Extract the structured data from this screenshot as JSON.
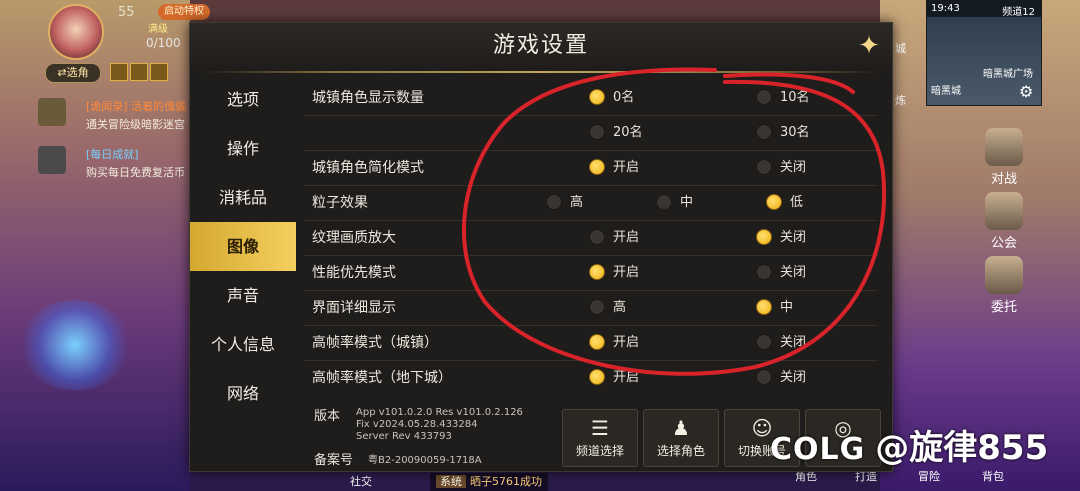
{
  "hud": {
    "level": "55",
    "full_badge": "满级",
    "boost_label": "启动特权",
    "hp_text": "0/100",
    "switch_label": "⇄选角",
    "quests": [
      {
        "title": "[诡闻录] 活着的傀儡",
        "desc": "通关冒险级暗影迷宫",
        "title_color": "#ff8a3a"
      },
      {
        "title": "[每日成就]",
        "desc": "购买每日免费复活币",
        "title_color": "#7ad0ff"
      }
    ]
  },
  "minimap": {
    "time": "19:43",
    "channel": "频道12",
    "map_name": "暗黑城",
    "area_label": "暗黑城广场"
  },
  "right_buttons": [
    {
      "label": "对战"
    },
    {
      "label": "公会"
    },
    {
      "label": "委托"
    }
  ],
  "side_labels": {
    "city": "城",
    "train": "炼"
  },
  "bottom": {
    "social": "社交",
    "chat_tag": "系统",
    "chat_text": "晒子5761成功",
    "bottom_right": [
      "角色",
      "打造",
      "冒险",
      "背包"
    ]
  },
  "watermark": {
    "logo": "COLG",
    "text": "@旋律855"
  },
  "panel": {
    "title": "游戏设置",
    "close_icon": "close-star-icon",
    "tabs": [
      {
        "label": "选项",
        "active": false
      },
      {
        "label": "操作",
        "active": false
      },
      {
        "label": "消耗品",
        "active": false
      },
      {
        "label": "图像",
        "active": true
      },
      {
        "label": "声音",
        "active": false
      },
      {
        "label": "个人信息",
        "active": false
      },
      {
        "label": "网络",
        "active": false
      }
    ],
    "settings": [
      {
        "label": "城镇角色显示数量",
        "options": [
          {
            "label": "0名",
            "selected": true
          },
          {
            "label": "10名",
            "selected": false
          }
        ]
      },
      {
        "label": "",
        "options": [
          {
            "label": "20名",
            "selected": false
          },
          {
            "label": "30名",
            "selected": false
          }
        ]
      },
      {
        "label": "城镇角色简化模式",
        "options": [
          {
            "label": "开启",
            "selected": true
          },
          {
            "label": "关闭",
            "selected": false
          }
        ]
      },
      {
        "label": "粒子效果",
        "options": [
          {
            "label": "高",
            "selected": false
          },
          {
            "label": "中",
            "selected": false
          },
          {
            "label": "低",
            "selected": true
          }
        ]
      },
      {
        "label": "纹理画质放大",
        "options": [
          {
            "label": "开启",
            "selected": false
          },
          {
            "label": "关闭",
            "selected": true
          }
        ]
      },
      {
        "label": "性能优先模式",
        "options": [
          {
            "label": "开启",
            "selected": true
          },
          {
            "label": "关闭",
            "selected": false
          }
        ]
      },
      {
        "label": "界面详细显示",
        "options": [
          {
            "label": "高",
            "selected": false
          },
          {
            "label": "中",
            "selected": true
          }
        ]
      },
      {
        "label": "高帧率模式（城镇）",
        "options": [
          {
            "label": "开启",
            "selected": true
          },
          {
            "label": "关闭",
            "selected": false
          }
        ]
      },
      {
        "label": "高帧率模式（地下城）",
        "options": [
          {
            "label": "开启",
            "selected": true
          },
          {
            "label": "关闭",
            "selected": false
          }
        ]
      }
    ],
    "version_label": "版本",
    "version_lines": [
      "App v101.0.2.0 Res v101.0.2.126",
      "Fix v2024.05.28.433284",
      "Server Rev 433793"
    ],
    "icp_label": "备案号",
    "icp_text": "粤B2-20090059-1718A",
    "actions": [
      {
        "label": "频道选择",
        "icon": "list-icon"
      },
      {
        "label": "选择角色",
        "icon": "person-pin-icon"
      },
      {
        "label": "切换账号",
        "icon": "users-icon"
      },
      {
        "label": "",
        "icon": "headset-icon"
      }
    ]
  },
  "colors": {
    "accent_gold": "#f0b010",
    "active_tab": "#e4bc48",
    "annotation_red": "#d8232a"
  }
}
